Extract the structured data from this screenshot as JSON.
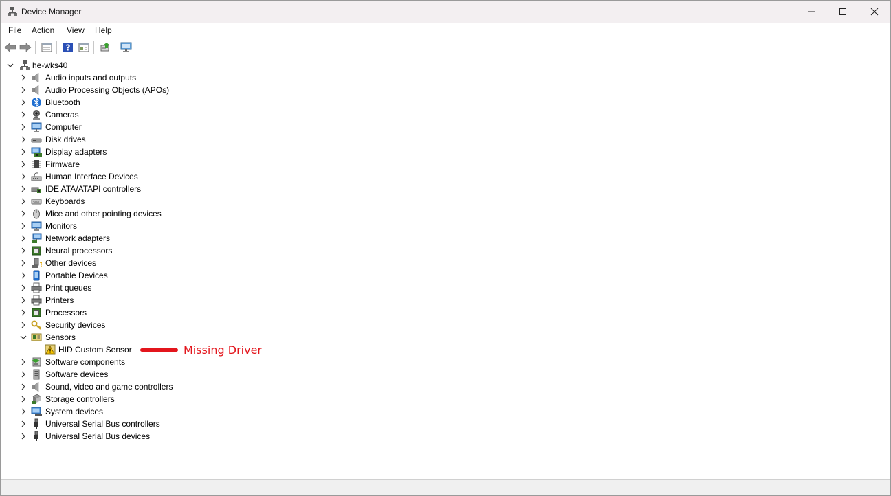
{
  "window": {
    "title": "Device Manager"
  },
  "menu": [
    "File",
    "Action",
    "View",
    "Help"
  ],
  "toolbar": [
    "back-icon",
    "forward-icon",
    "properties-icon",
    "help-icon",
    "view-icon",
    "update-driver-icon",
    "scan-hardware-icon"
  ],
  "tree": {
    "root": "he-wks40",
    "categories": [
      {
        "label": "Audio inputs and outputs",
        "icon": "speaker-icon"
      },
      {
        "label": "Audio Processing Objects (APOs)",
        "icon": "speaker-icon"
      },
      {
        "label": "Bluetooth",
        "icon": "bluetooth-icon"
      },
      {
        "label": "Cameras",
        "icon": "camera-icon"
      },
      {
        "label": "Computer",
        "icon": "monitor-icon"
      },
      {
        "label": "Disk drives",
        "icon": "disk-drive-icon"
      },
      {
        "label": "Display adapters",
        "icon": "display-adapter-icon"
      },
      {
        "label": "Firmware",
        "icon": "chip-icon"
      },
      {
        "label": "Human Interface Devices",
        "icon": "hid-icon"
      },
      {
        "label": "IDE ATA/ATAPI controllers",
        "icon": "ide-controller-icon"
      },
      {
        "label": "Keyboards",
        "icon": "keyboard-icon"
      },
      {
        "label": "Mice and other pointing devices",
        "icon": "mouse-icon"
      },
      {
        "label": "Monitors",
        "icon": "monitor-icon"
      },
      {
        "label": "Network adapters",
        "icon": "network-icon"
      },
      {
        "label": "Neural processors",
        "icon": "processor-icon"
      },
      {
        "label": "Other devices",
        "icon": "unknown-device-icon"
      },
      {
        "label": "Portable Devices",
        "icon": "portable-device-icon"
      },
      {
        "label": "Print queues",
        "icon": "printer-icon"
      },
      {
        "label": "Printers",
        "icon": "printer-icon"
      },
      {
        "label": "Processors",
        "icon": "processor-icon"
      },
      {
        "label": "Security devices",
        "icon": "key-icon"
      },
      {
        "label": "Sensors",
        "icon": "sensor-icon",
        "expanded": true,
        "children": [
          {
            "label": "HID Custom Sensor",
            "icon": "warning-icon"
          }
        ]
      },
      {
        "label": "Software components",
        "icon": "software-component-icon"
      },
      {
        "label": "Software devices",
        "icon": "software-device-icon"
      },
      {
        "label": "Sound, video and game controllers",
        "icon": "speaker-icon"
      },
      {
        "label": "Storage controllers",
        "icon": "storage-controller-icon"
      },
      {
        "label": "System devices",
        "icon": "system-device-icon"
      },
      {
        "label": "Universal Serial Bus controllers",
        "icon": "usb-icon"
      },
      {
        "label": "Universal Serial Bus devices",
        "icon": "usb-icon"
      }
    ]
  },
  "annotation": {
    "text": "Missing Driver",
    "color": "#e3151c"
  }
}
